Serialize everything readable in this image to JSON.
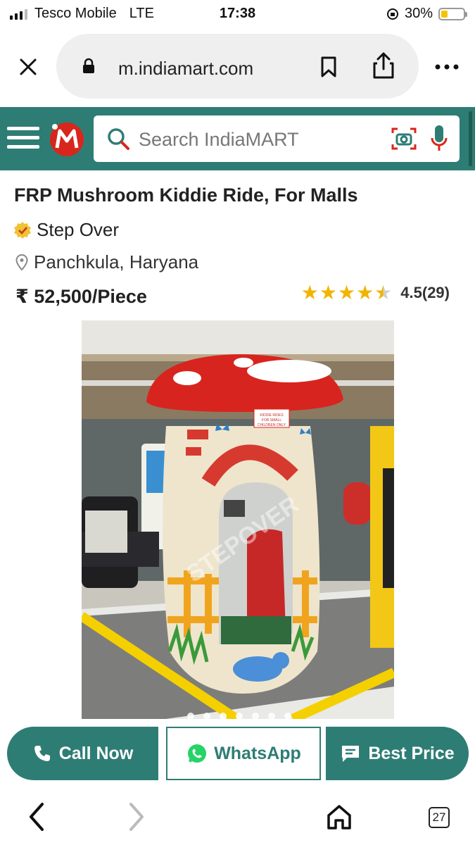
{
  "status_bar": {
    "carrier": "Tesco Mobile",
    "network": "LTE",
    "time": "17:38",
    "battery_percent": "30%",
    "battery_level": 0.3
  },
  "browser": {
    "url": "m.indiamart.com",
    "icons": [
      "close-icon",
      "lock-icon",
      "bookmark-icon",
      "share-icon",
      "more-icon"
    ]
  },
  "header": {
    "search_placeholder": "Search IndiaMART",
    "brand_color": "#2e7d75",
    "icons": [
      "menu-icon",
      "indiamart-logo",
      "search-icon",
      "camera-search-icon",
      "mic-icon"
    ]
  },
  "product": {
    "title": "FRP Mushroom Kiddie Ride, For Malls",
    "seller": "Step Over",
    "location": "Panchkula, Haryana",
    "price": "₹ 52,500/Piece",
    "rating_text": "4.5(29)",
    "rating_value": 4.5,
    "image_sign": "KIDDIE RIDES FOR SMALL CHILDREN ONLY",
    "watermark": "STEPOVER"
  },
  "actions": {
    "call": "Call Now",
    "whatsapp": "WhatsApp",
    "best_price": "Best Price"
  },
  "bottom_nav": {
    "tab_count": "27",
    "icons": [
      "back-icon",
      "forward-icon",
      "home-icon",
      "tabs-icon"
    ]
  }
}
